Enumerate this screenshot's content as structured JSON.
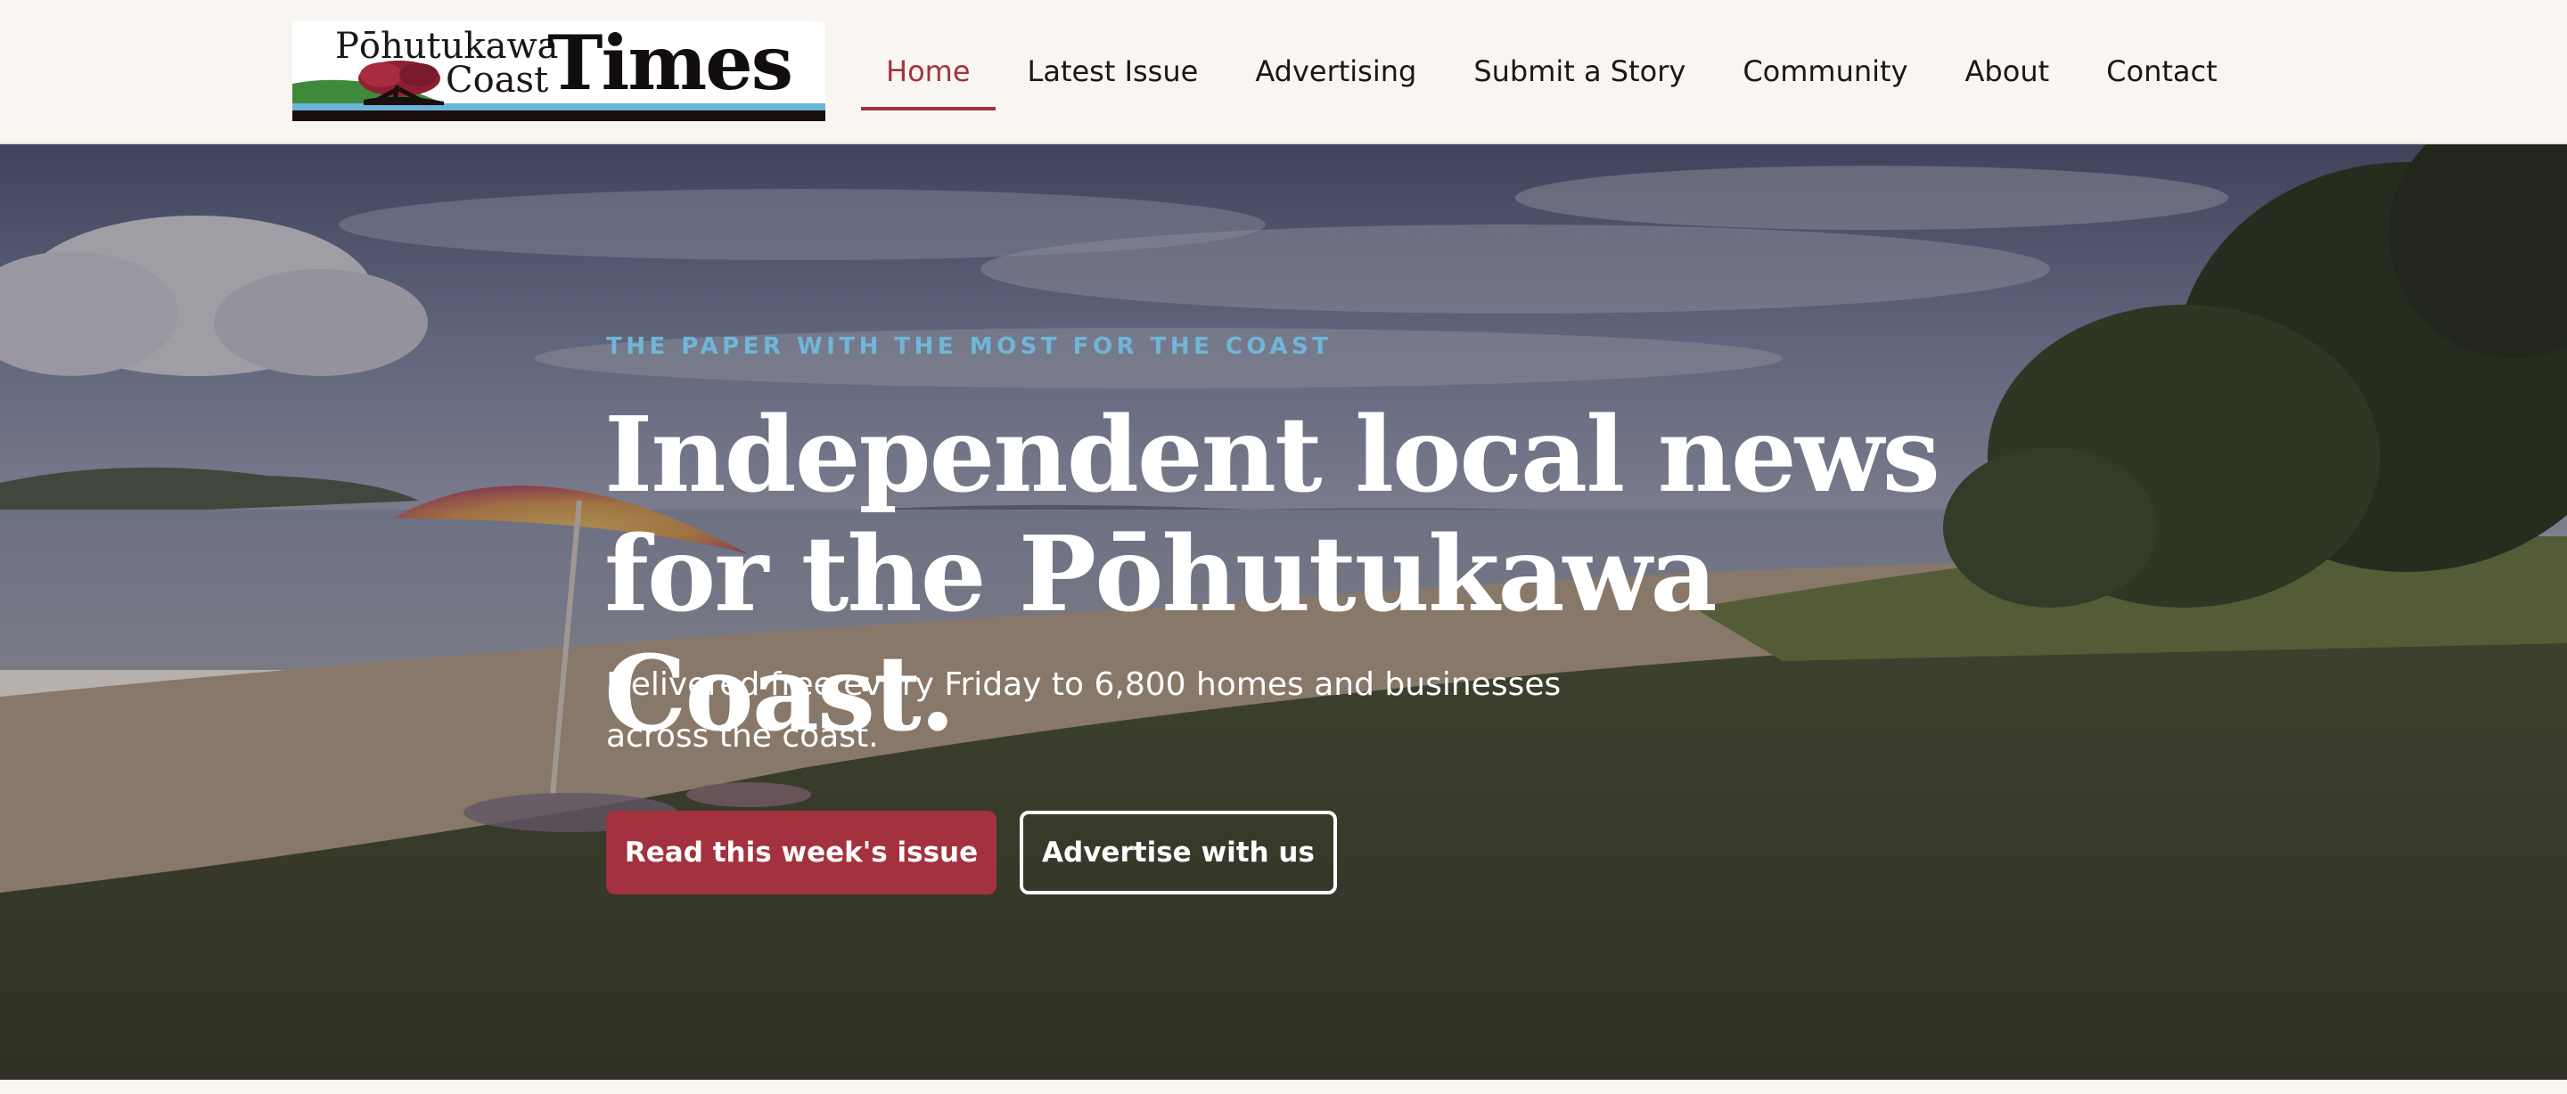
{
  "header": {
    "logo": {
      "line1": "Pōhutukawa",
      "line2": "Coast",
      "title": "Times"
    },
    "nav": {
      "items": [
        {
          "label": "Home",
          "active": true
        },
        {
          "label": "Latest Issue",
          "active": false
        },
        {
          "label": "Advertising",
          "active": false
        },
        {
          "label": "Submit a Story",
          "active": false
        },
        {
          "label": "Community",
          "active": false
        },
        {
          "label": "About",
          "active": false
        },
        {
          "label": "Contact",
          "active": false
        }
      ]
    }
  },
  "hero": {
    "eyebrow": "THE PAPER WITH THE MOST FOR THE COAST",
    "headline": "Independent local news for the Pōhutukawa Coast.",
    "subtext": "Delivered free every Friday to 6,800 homes and businesses across the coast.",
    "primary_button": "Read this week's issue",
    "secondary_button": "Advertise with us"
  },
  "colors": {
    "accent": "#a3323e",
    "eyebrow": "#6fb6d8",
    "header_bg": "#f9f6f1",
    "text_dark": "#1e1616"
  }
}
